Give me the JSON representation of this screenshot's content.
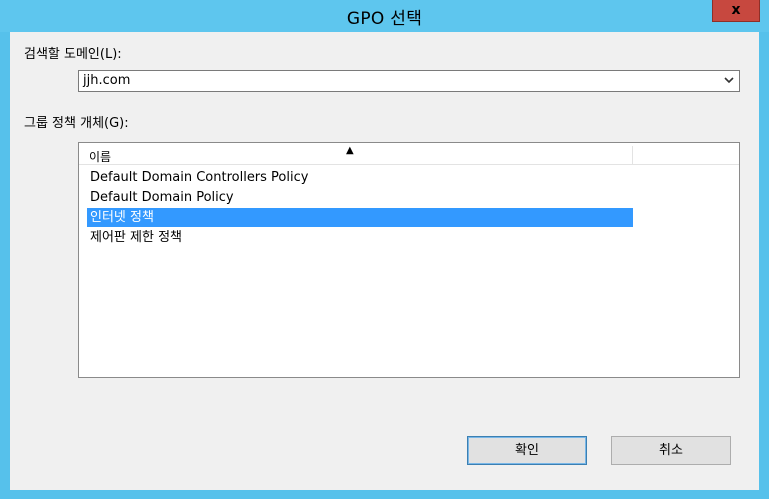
{
  "window": {
    "title": "GPO 선택",
    "close_label": "x"
  },
  "domain": {
    "label": "검색할 도메인(L):",
    "value": "jjh.com",
    "dropdown_icon": "chevron-down-icon"
  },
  "gpo_list": {
    "label": "그룹 정책 개체(G):",
    "column_header": "이름",
    "sort_icon": "sort-ascending-icon",
    "rows": [
      {
        "name": "Default Domain Controllers Policy",
        "selected": false
      },
      {
        "name": "Default Domain Policy",
        "selected": false
      },
      {
        "name": "인터넷 정책",
        "selected": true
      },
      {
        "name": "제어판 제한 정책",
        "selected": false
      }
    ]
  },
  "buttons": {
    "ok_label": "확인",
    "cancel_label": "취소"
  },
  "colors": {
    "titlebar": "#5ec6ee",
    "selection": "#3399ff",
    "close": "#c7483f"
  }
}
